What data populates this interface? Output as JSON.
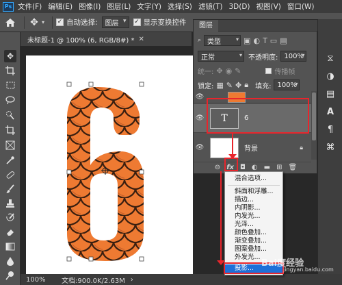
{
  "menu": {
    "items": [
      "文件(F)",
      "编辑(E)",
      "图像(I)",
      "图层(L)",
      "文字(Y)",
      "选择(S)",
      "滤镜(T)",
      "3D(D)",
      "视图(V)",
      "窗口(W)"
    ]
  },
  "options_bar": {
    "auto_select_label": "自动选择:",
    "auto_select_value": "图层",
    "show_transform_label": "显示变换控件"
  },
  "document": {
    "tab_title": "未标题-1 @ 100% (6, RGB/8#) *",
    "artwork_text": "6",
    "zoom": "100%",
    "doc_info": "文档:900.0K/2.63M"
  },
  "layers_panel": {
    "title": "图层",
    "filter_kind": "类型",
    "blend_mode": "正常",
    "opacity_label": "不透明度:",
    "opacity_value": "100%",
    "lock_label": "锁定:",
    "fill_label": "填充:",
    "fill_value": "100%",
    "unify_label": "统一:",
    "propagate_label": "传播帧",
    "layers": [
      {
        "name": "6",
        "type": "text",
        "thumb_text": "T"
      },
      {
        "name": "背景",
        "type": "background"
      }
    ],
    "fx_label": "fx"
  },
  "fx_menu": {
    "items": [
      "混合选项...",
      "斜面和浮雕...",
      "描边...",
      "内阴影...",
      "内发光...",
      "光泽...",
      "颜色叠加...",
      "渐变叠加...",
      "图案叠加...",
      "外发光...",
      "投影..."
    ],
    "highlighted": "投影..."
  },
  "watermark": {
    "brand": "Bai度经验",
    "url": "jingyan.baidu.com"
  },
  "colors": {
    "accent_red": "#e8252c",
    "tile_orange": "#ee7a32",
    "highlight_blue": "#1e70d8"
  }
}
